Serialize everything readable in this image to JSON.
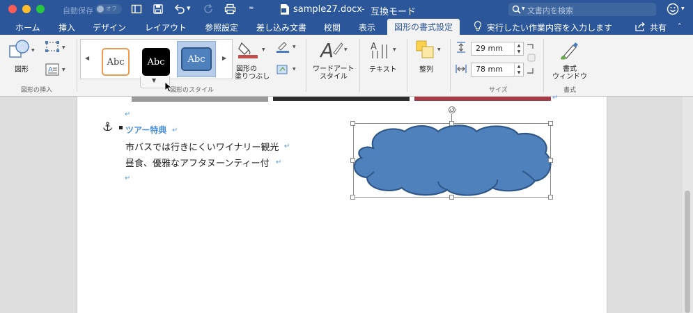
{
  "titlebar": {
    "autosave_label": "自動保存",
    "autosave_state": "オフ",
    "doc_title": "sample27.docx",
    "title_separator": "-",
    "mode": "互換モード",
    "search_placeholder": "文書内を検索"
  },
  "tabs": [
    "ホーム",
    "挿入",
    "デザイン",
    "レイアウト",
    "参照設定",
    "差し込み文書",
    "校閲",
    "表示",
    "図形の書式設定"
  ],
  "tell_me": "実行したい作業内容を入力します",
  "share": "共有",
  "ribbon": {
    "shape_btn": "図形",
    "group_insert": "図形の挿入",
    "style_sample": "Abc",
    "group_styles": "図形のスタイル",
    "fill_btn_line1": "図形の",
    "fill_btn_line2": "塗りつぶし",
    "wordart_line1": "ワードアート",
    "wordart_line2": "スタイル",
    "text_btn": "テキスト",
    "arrange_btn": "整列",
    "height_value": "29 mm",
    "width_value": "78 mm",
    "group_size": "サイズ",
    "format_line1": "書式",
    "format_line2": "ウィンドウ",
    "group_format": "書式"
  },
  "document": {
    "heading": "ツアー特典",
    "line1": "市バスでは行きにくいワイナリー観光",
    "line2": "昼食、優雅なアフタヌーンティー付",
    "para_mark": "↵"
  },
  "colors": {
    "accent": "#2b579a",
    "cloud_fill": "#4f81bd",
    "cloud_stroke": "#2f5788",
    "heading_text": "#4a90d9"
  }
}
